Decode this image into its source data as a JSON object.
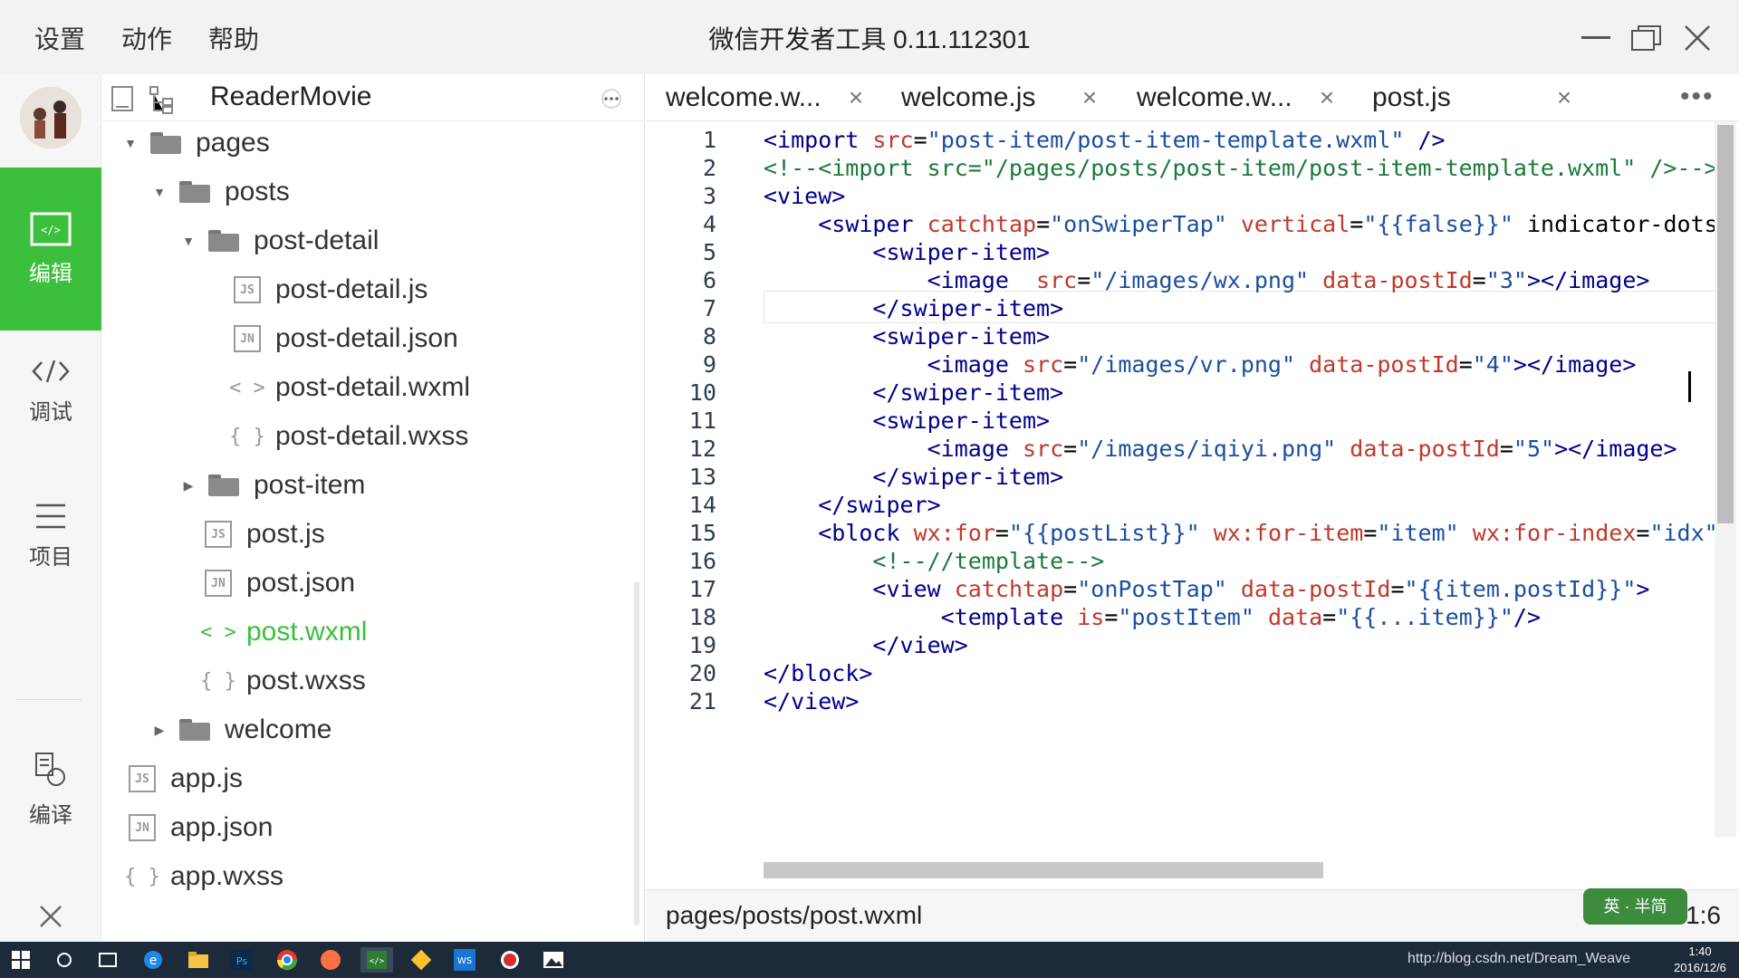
{
  "menu": {
    "settings": "设置",
    "actions": "动作",
    "help": "帮助"
  },
  "window": {
    "title": "微信开发者工具 0.11.112301"
  },
  "rail": {
    "edit": "编辑",
    "debug": "调试",
    "project": "项目",
    "compile": "编译"
  },
  "tree": {
    "project_name": "ReaderMovie",
    "rows": [
      {
        "label": "pages"
      },
      {
        "label": "posts"
      },
      {
        "label": "post-detail"
      },
      {
        "label": "post-detail.js",
        "badge": "JS"
      },
      {
        "label": "post-detail.json",
        "badge": "JN"
      },
      {
        "label": "post-detail.wxml",
        "badge": "< >"
      },
      {
        "label": "post-detail.wxss",
        "badge": "{ }"
      },
      {
        "label": "post-item"
      },
      {
        "label": "post.js",
        "badge": "JS"
      },
      {
        "label": "post.json",
        "badge": "JN"
      },
      {
        "label": "post.wxml",
        "badge": "< >"
      },
      {
        "label": "post.wxss",
        "badge": "{ }"
      },
      {
        "label": "welcome"
      },
      {
        "label": "app.js",
        "badge": "JS"
      },
      {
        "label": "app.json",
        "badge": "JN"
      },
      {
        "label": "app.wxss",
        "badge": "{ }"
      }
    ]
  },
  "tabs": [
    {
      "label": "welcome.w..."
    },
    {
      "label": "welcome.js"
    },
    {
      "label": "welcome.w..."
    },
    {
      "label": "post.js"
    }
  ],
  "editor": {
    "lines": [
      {
        "n": "1",
        "t": "<import src=\"post-item/post-item-template.wxml\" />"
      },
      {
        "n": "2",
        "t": "<!--<import src=\"/pages/posts/post-item/post-item-template.wxml\" />-->"
      },
      {
        "n": "3",
        "t": "<view>"
      },
      {
        "n": "4",
        "t": "    <swiper catchtap=\"onSwiperTap\" vertical=\"{{false}}\" indicator-dots"
      },
      {
        "n": "5",
        "t": "        <swiper-item>"
      },
      {
        "n": "6",
        "t": "            <image  src=\"/images/wx.png\" data-postId=\"3\"></image>"
      },
      {
        "n": "7",
        "t": "        </swiper-item>"
      },
      {
        "n": "8",
        "t": "        <swiper-item>"
      },
      {
        "n": "9",
        "t": "            <image src=\"/images/vr.png\" data-postId=\"4\"></image>"
      },
      {
        "n": "10",
        "t": "        </swiper-item>"
      },
      {
        "n": "11",
        "t": "        <swiper-item>"
      },
      {
        "n": "12",
        "t": "            <image src=\"/images/iqiyi.png\" data-postId=\"5\"></image>"
      },
      {
        "n": "13",
        "t": "        </swiper-item>"
      },
      {
        "n": "14",
        "t": "    </swiper>"
      },
      {
        "n": "15",
        "t": "    <block wx:for=\"{{postList}}\" wx:for-item=\"item\" wx:for-index=\"idx\""
      },
      {
        "n": "16",
        "t": "        <!--//template-->"
      },
      {
        "n": "17",
        "t": "        <view catchtap=\"onPostTap\" data-postId=\"{{item.postId}}\">"
      },
      {
        "n": "18",
        "t": "             <template is=\"postItem\" data=\"{{...item}}\"/>"
      },
      {
        "n": "19",
        "t": "        </view>"
      },
      {
        "n": "20",
        "t": "</block>"
      },
      {
        "n": "21",
        "t": "</view>"
      }
    ]
  },
  "status": {
    "path": "pages/posts/post.wxml",
    "position": "21:6"
  },
  "ime": {
    "label": "英 · 半简"
  },
  "taskbar": {
    "time": "1:40",
    "date": "2016/12/6",
    "watermark": "http://blog.csdn.net/Dream_Weave"
  },
  "colors": {
    "accent": "#3cbf3c",
    "tag": "#00008b",
    "attr": "#c0392b",
    "string": "#1a4fa0",
    "comment": "#1b7a3a"
  }
}
